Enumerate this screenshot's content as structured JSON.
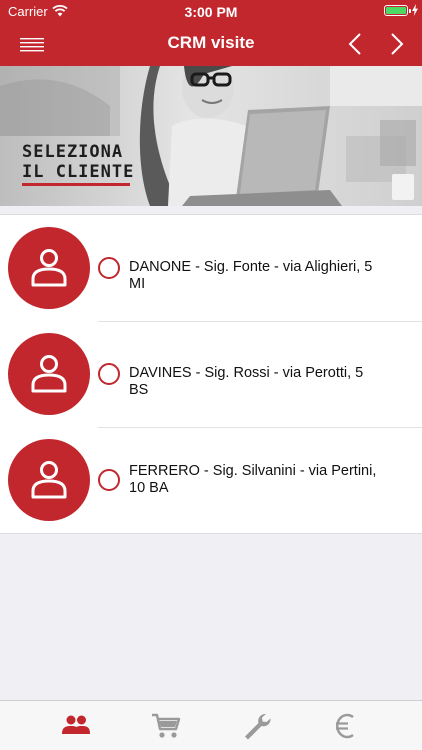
{
  "status_bar": {
    "carrier": "Carrier",
    "time": "3:00 PM",
    "battery_level": 1.0
  },
  "nav": {
    "title": "CRM visite",
    "menu_icon": "hamburger-menu-icon",
    "prev_icon": "chevron-left-icon",
    "next_icon": "chevron-right-icon"
  },
  "hero": {
    "line1": "SELEZIONA",
    "line2": "IL CLIENTE"
  },
  "clients": [
    {
      "text": "DANONE - Sig. Fonte - via Alighieri, 5 MI",
      "selected": false
    },
    {
      "text": "DAVINES - Sig. Rossi - via Perotti, 5 BS",
      "selected": false
    },
    {
      "text": "FERRERO - Sig. Silvanini - via Pertini, 10 BA",
      "selected": false
    }
  ],
  "tabs": [
    {
      "icon": "people-icon",
      "active": true
    },
    {
      "icon": "cart-icon",
      "active": false
    },
    {
      "icon": "wrench-icon",
      "active": false
    },
    {
      "icon": "euro-icon",
      "active": false
    }
  ],
  "colors": {
    "brand_red": "#c1272d",
    "battery_green": "#4cd964",
    "tab_inactive": "#9a9a9a"
  }
}
